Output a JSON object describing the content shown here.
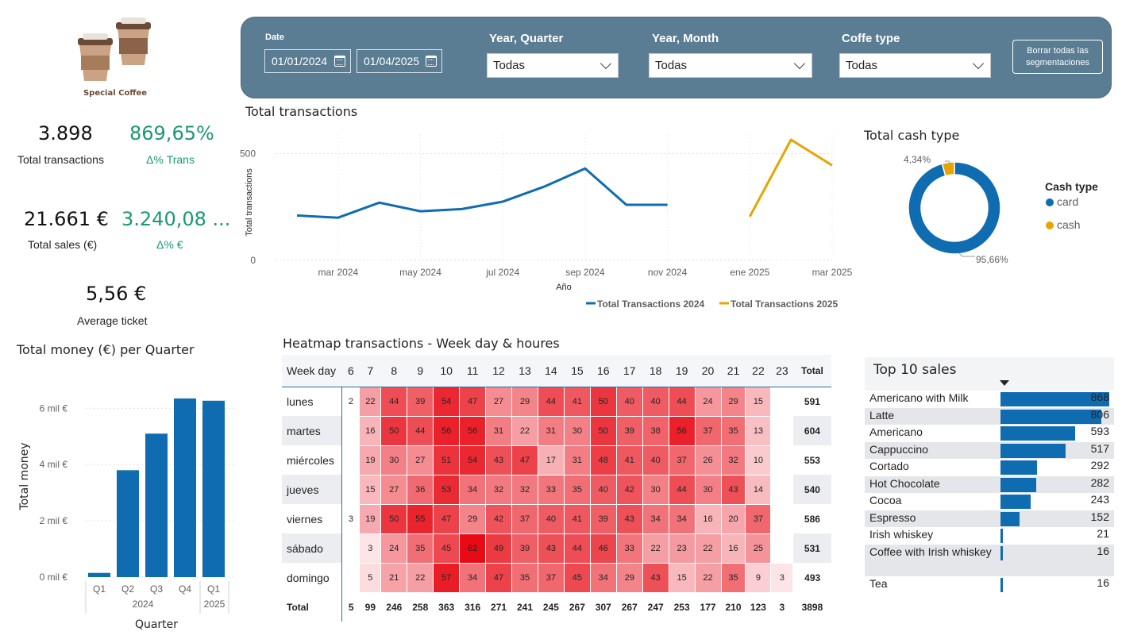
{
  "logo": {
    "text": "Special Coffee",
    "icon": "coffee-cups-icon"
  },
  "kpis": {
    "transactions": {
      "value": "3.898",
      "label": "Total transactions"
    },
    "delta_trans": {
      "value": "869,65%",
      "label": "Δ% Trans"
    },
    "sales": {
      "value": "21.661 €",
      "label": "Total sales (€)"
    },
    "delta_sales": {
      "value": "3.240,08 ...",
      "label": "Δ% €"
    },
    "ticket": {
      "value": "5,56 €",
      "label": "Average ticket"
    }
  },
  "filters": {
    "date_title": "Date",
    "date_from": "01/01/2024",
    "date_to": "01/04/2025",
    "year_quarter": {
      "title": "Year, Quarter",
      "value": "Todas"
    },
    "year_month": {
      "title": "Year, Month",
      "value": "Todas"
    },
    "coffee_type": {
      "title": "Coffe type",
      "value": "Todas"
    },
    "clear_button": "Borrar todas las segmentaciones"
  },
  "colors": {
    "primary": "#0f6cb0",
    "secondary": "#e6a500",
    "panel": "#5b7d94",
    "positive": "#1a9a6c"
  },
  "line_chart": {
    "title": "Total transactions",
    "xlabel": "Año",
    "ylabel": "Total transactions",
    "ytick_labels": [
      "0",
      "500"
    ],
    "xtick_labels": [
      "mar 2024",
      "may 2024",
      "jul 2024",
      "sep 2024",
      "nov 2024",
      "ene 2025",
      "mar 2025"
    ],
    "legend": [
      "Total Transactions 2024",
      "Total Transactions 2025"
    ]
  },
  "donut": {
    "title": "Total cash type",
    "legend_title": "Cash type",
    "labels": [
      "card",
      "cash"
    ],
    "pct_labels": [
      "95,66%",
      "4,34%"
    ]
  },
  "bar_chart": {
    "title": "Total money (€) per Quarter",
    "ylabel": "Total money",
    "xlabel": "Quarter",
    "ytick_labels": [
      "0 mil €",
      "2 mil €",
      "4 mil €",
      "6 mil €"
    ],
    "years": [
      "2024",
      "2025"
    ]
  },
  "heatmap": {
    "title": "Heatmap transactions - Week day & houres",
    "row_header": "Week day",
    "total_label": "Total",
    "hours": [
      "6",
      "7",
      "8",
      "9",
      "10",
      "11",
      "12",
      "13",
      "14",
      "15",
      "16",
      "17",
      "18",
      "19",
      "20",
      "21",
      "22",
      "23"
    ],
    "days": [
      "lunes",
      "martes",
      "miércoles",
      "jueves",
      "viernes",
      "sábado",
      "domingo"
    ],
    "cells": [
      [
        2,
        22,
        44,
        39,
        54,
        47,
        27,
        29,
        44,
        41,
        50,
        40,
        40,
        44,
        24,
        29,
        15,
        null
      ],
      [
        null,
        16,
        50,
        44,
        56,
        56,
        31,
        22,
        31,
        30,
        50,
        39,
        38,
        56,
        37,
        35,
        13,
        null
      ],
      [
        null,
        19,
        30,
        27,
        51,
        54,
        43,
        47,
        17,
        31,
        48,
        41,
        40,
        37,
        26,
        32,
        10,
        null
      ],
      [
        null,
        15,
        27,
        36,
        53,
        34,
        32,
        32,
        33,
        35,
        40,
        42,
        30,
        44,
        30,
        43,
        14,
        null
      ],
      [
        3,
        19,
        50,
        55,
        47,
        29,
        42,
        37,
        40,
        41,
        39,
        43,
        34,
        34,
        16,
        20,
        37,
        null
      ],
      [
        null,
        3,
        24,
        35,
        45,
        62,
        49,
        39,
        43,
        44,
        46,
        33,
        22,
        23,
        22,
        16,
        25,
        null
      ],
      [
        null,
        5,
        21,
        22,
        57,
        34,
        47,
        35,
        37,
        45,
        34,
        29,
        43,
        15,
        22,
        35,
        9,
        3
      ]
    ],
    "row_totals": [
      591,
      604,
      553,
      540,
      586,
      531,
      493
    ],
    "col_totals": [
      5,
      99,
      246,
      258,
      363,
      316,
      271,
      241,
      245,
      267,
      307,
      267,
      247,
      253,
      177,
      210,
      123,
      3
    ],
    "grand_total": 3898
  },
  "top10": {
    "title": "Top 10 sales",
    "items": [
      {
        "name": "Americano with Milk",
        "value": 868
      },
      {
        "name": "Latte",
        "value": 806
      },
      {
        "name": "Americano",
        "value": 593
      },
      {
        "name": "Cappuccino",
        "value": 517
      },
      {
        "name": "Cortado",
        "value": 292
      },
      {
        "name": "Hot Chocolate",
        "value": 282
      },
      {
        "name": "Cocoa",
        "value": 243
      },
      {
        "name": "Espresso",
        "value": 152
      },
      {
        "name": "Irish whiskey",
        "value": 21
      },
      {
        "name": "Coffee with Irish whiskey",
        "value": 16
      },
      {
        "name": "Tea",
        "value": 16
      }
    ]
  },
  "chart_data": [
    {
      "type": "line",
      "title": "Total transactions",
      "xlabel": "Año",
      "ylabel": "Total transactions",
      "ylim": [
        0,
        600
      ],
      "series": [
        {
          "name": "Total Transactions 2024",
          "x": [
            "2024-02",
            "2024-03",
            "2024-04",
            "2024-05",
            "2024-06",
            "2024-07",
            "2024-08",
            "2024-09",
            "2024-10",
            "2024-11",
            "2024-12"
          ],
          "values": [
            210,
            200,
            270,
            230,
            240,
            275,
            345,
            430,
            260,
            260,
            null
          ]
        },
        {
          "name": "Total Transactions 2025",
          "x": [
            "2025-01",
            "2025-02",
            "2025-03"
          ],
          "values": [
            205,
            565,
            445
          ]
        }
      ]
    },
    {
      "type": "pie",
      "title": "Total cash type",
      "categories": [
        "card",
        "cash"
      ],
      "values": [
        95.66,
        4.34
      ]
    },
    {
      "type": "bar",
      "title": "Total money (€) per Quarter",
      "xlabel": "Quarter",
      "ylabel": "Total money",
      "categories": [
        "2024 Q1",
        "2024 Q2",
        "2024 Q3",
        "2024 Q4",
        "2025 Q1"
      ],
      "values": [
        150,
        3800,
        5100,
        6350,
        6270
      ],
      "ylim": [
        0,
        6800
      ]
    },
    {
      "type": "bar",
      "title": "Top 10 sales",
      "categories": [
        "Americano with Milk",
        "Latte",
        "Americano",
        "Cappuccino",
        "Cortado",
        "Hot Chocolate",
        "Cocoa",
        "Espresso",
        "Irish whiskey",
        "Coffee with Irish whiskey",
        "Tea"
      ],
      "values": [
        868,
        806,
        593,
        517,
        292,
        282,
        243,
        152,
        21,
        16,
        16
      ]
    }
  ]
}
